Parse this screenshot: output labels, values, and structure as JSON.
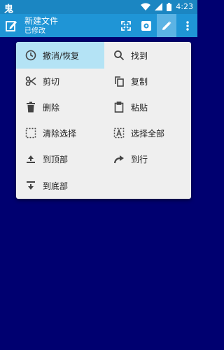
{
  "status_bar": {
    "carrier_glyph": "鬼",
    "time": "4:23"
  },
  "app_bar": {
    "title": "新建文件",
    "subtitle": "已修改",
    "actions": [
      "fullscreen-icon",
      "settings-icon",
      "edit-icon",
      "more-icon"
    ]
  },
  "menu": {
    "items": [
      {
        "label": "撤消/恢复",
        "icon": "history-icon"
      },
      {
        "label": "找到",
        "icon": "search-icon"
      },
      {
        "label": "剪切",
        "icon": "scissors-icon"
      },
      {
        "label": "复制",
        "icon": "copy-icon"
      },
      {
        "label": "删除",
        "icon": "trash-icon"
      },
      {
        "label": "粘贴",
        "icon": "clipboard-icon"
      },
      {
        "label": "清除选择",
        "icon": "deselect-icon"
      },
      {
        "label": "选择全部",
        "icon": "select-all-icon"
      },
      {
        "label": "到顶部",
        "icon": "to-top-icon"
      },
      {
        "label": "到行",
        "icon": "goto-line-icon"
      },
      {
        "label": "到底部",
        "icon": "to-bottom-icon"
      }
    ]
  },
  "colors": {
    "status_bar": "#1B86C2",
    "app_bar": "#1F95D6",
    "background": "#000070",
    "menu_bg": "#EFEFEF",
    "highlight": "#B4E3F5"
  }
}
